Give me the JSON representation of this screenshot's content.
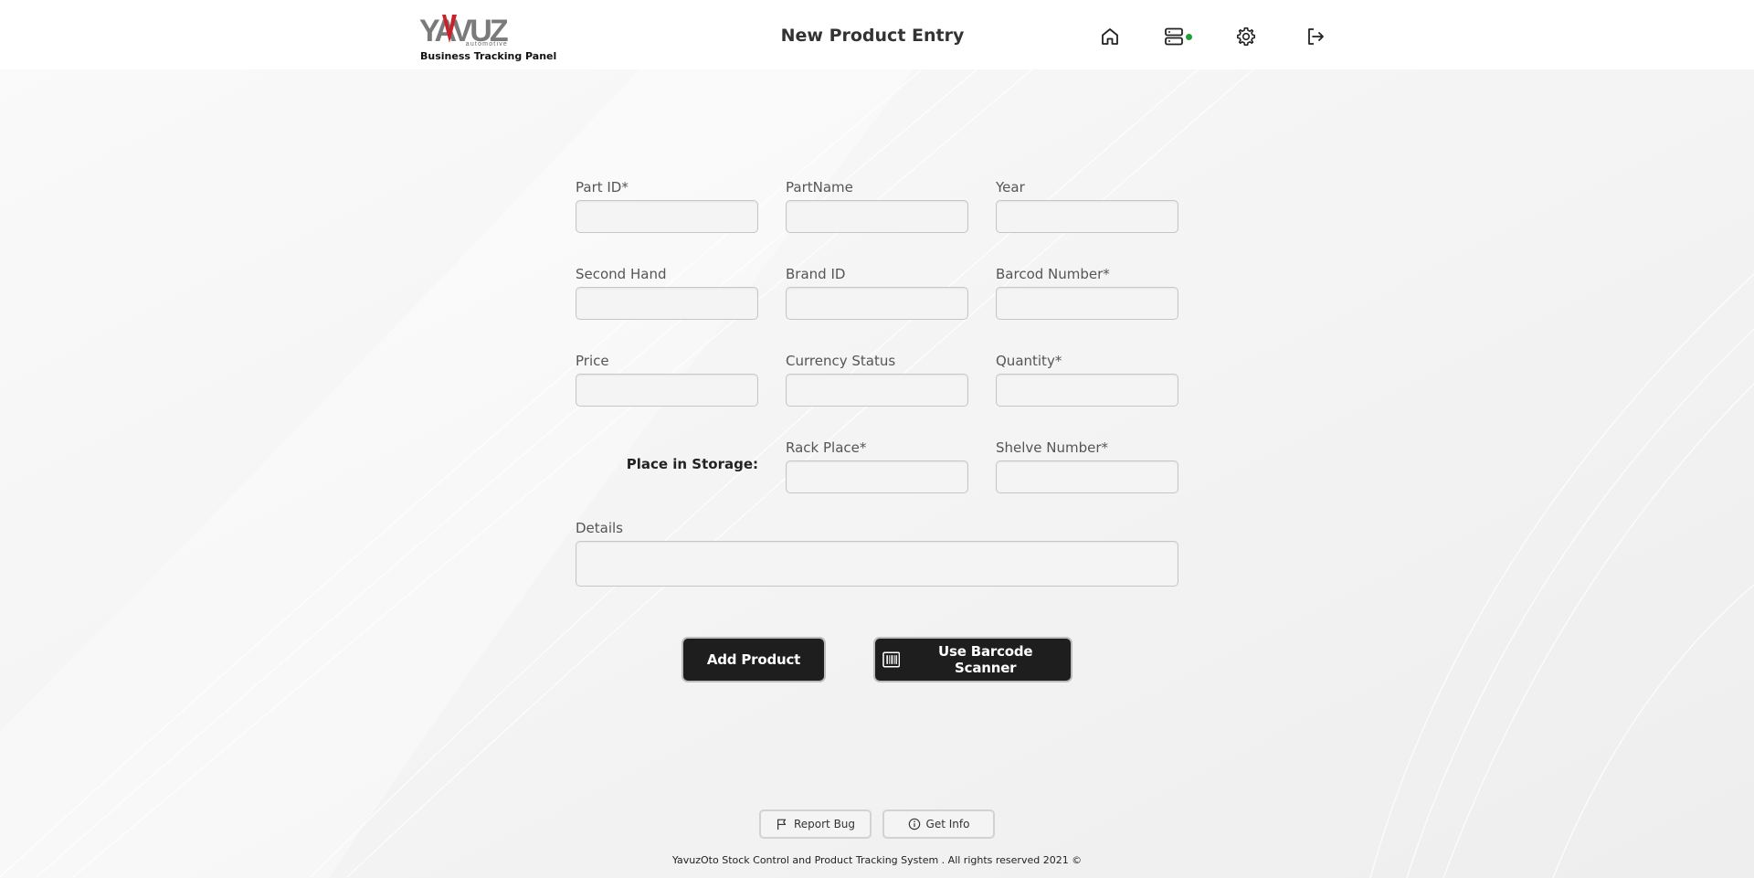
{
  "header": {
    "logo_text": "YAVUZ",
    "logo_tagline": "automotive",
    "logo_subtitle": "Business Tracking Panel",
    "page_title": "New Product Entry",
    "icons": [
      "home-icon",
      "server-icon",
      "gear-icon",
      "logout-icon"
    ],
    "status_color": "#1f9e3a"
  },
  "form": {
    "part_id_label": "Part ID*",
    "part_name_label": "PartName",
    "year_label": "Year",
    "second_hand_label": "Second Hand",
    "brand_id_label": "Brand ID",
    "barcode_number_label": "Barcod Number*",
    "price_label": "Price",
    "currency_status_label": "Currency Status",
    "quantity_label": "Quantity*",
    "storage_label": "Place in Storage:",
    "rack_place_label": "Rack Place*",
    "shelve_number_label": "Shelve Number*",
    "details_label": "Details",
    "values": {
      "part_id": "",
      "part_name": "",
      "year": "",
      "second_hand": "",
      "brand_id": "",
      "barcode_number": "",
      "price": "",
      "currency_status": "",
      "quantity": "",
      "rack_place": "",
      "shelve_number": "",
      "details": ""
    }
  },
  "actions": {
    "add_product_label": "Add Product",
    "barcode_scanner_label": "Use Barcode Scanner"
  },
  "footer": {
    "report_bug_label": "Report Bug",
    "get_info_label": "Get Info",
    "copyright": "YavuzOto Stock Control and Product Tracking System . All rights reserved 2021 ©"
  },
  "colors": {
    "button_dark": "#1e1e1e",
    "accent_logo": "#c8232c"
  }
}
